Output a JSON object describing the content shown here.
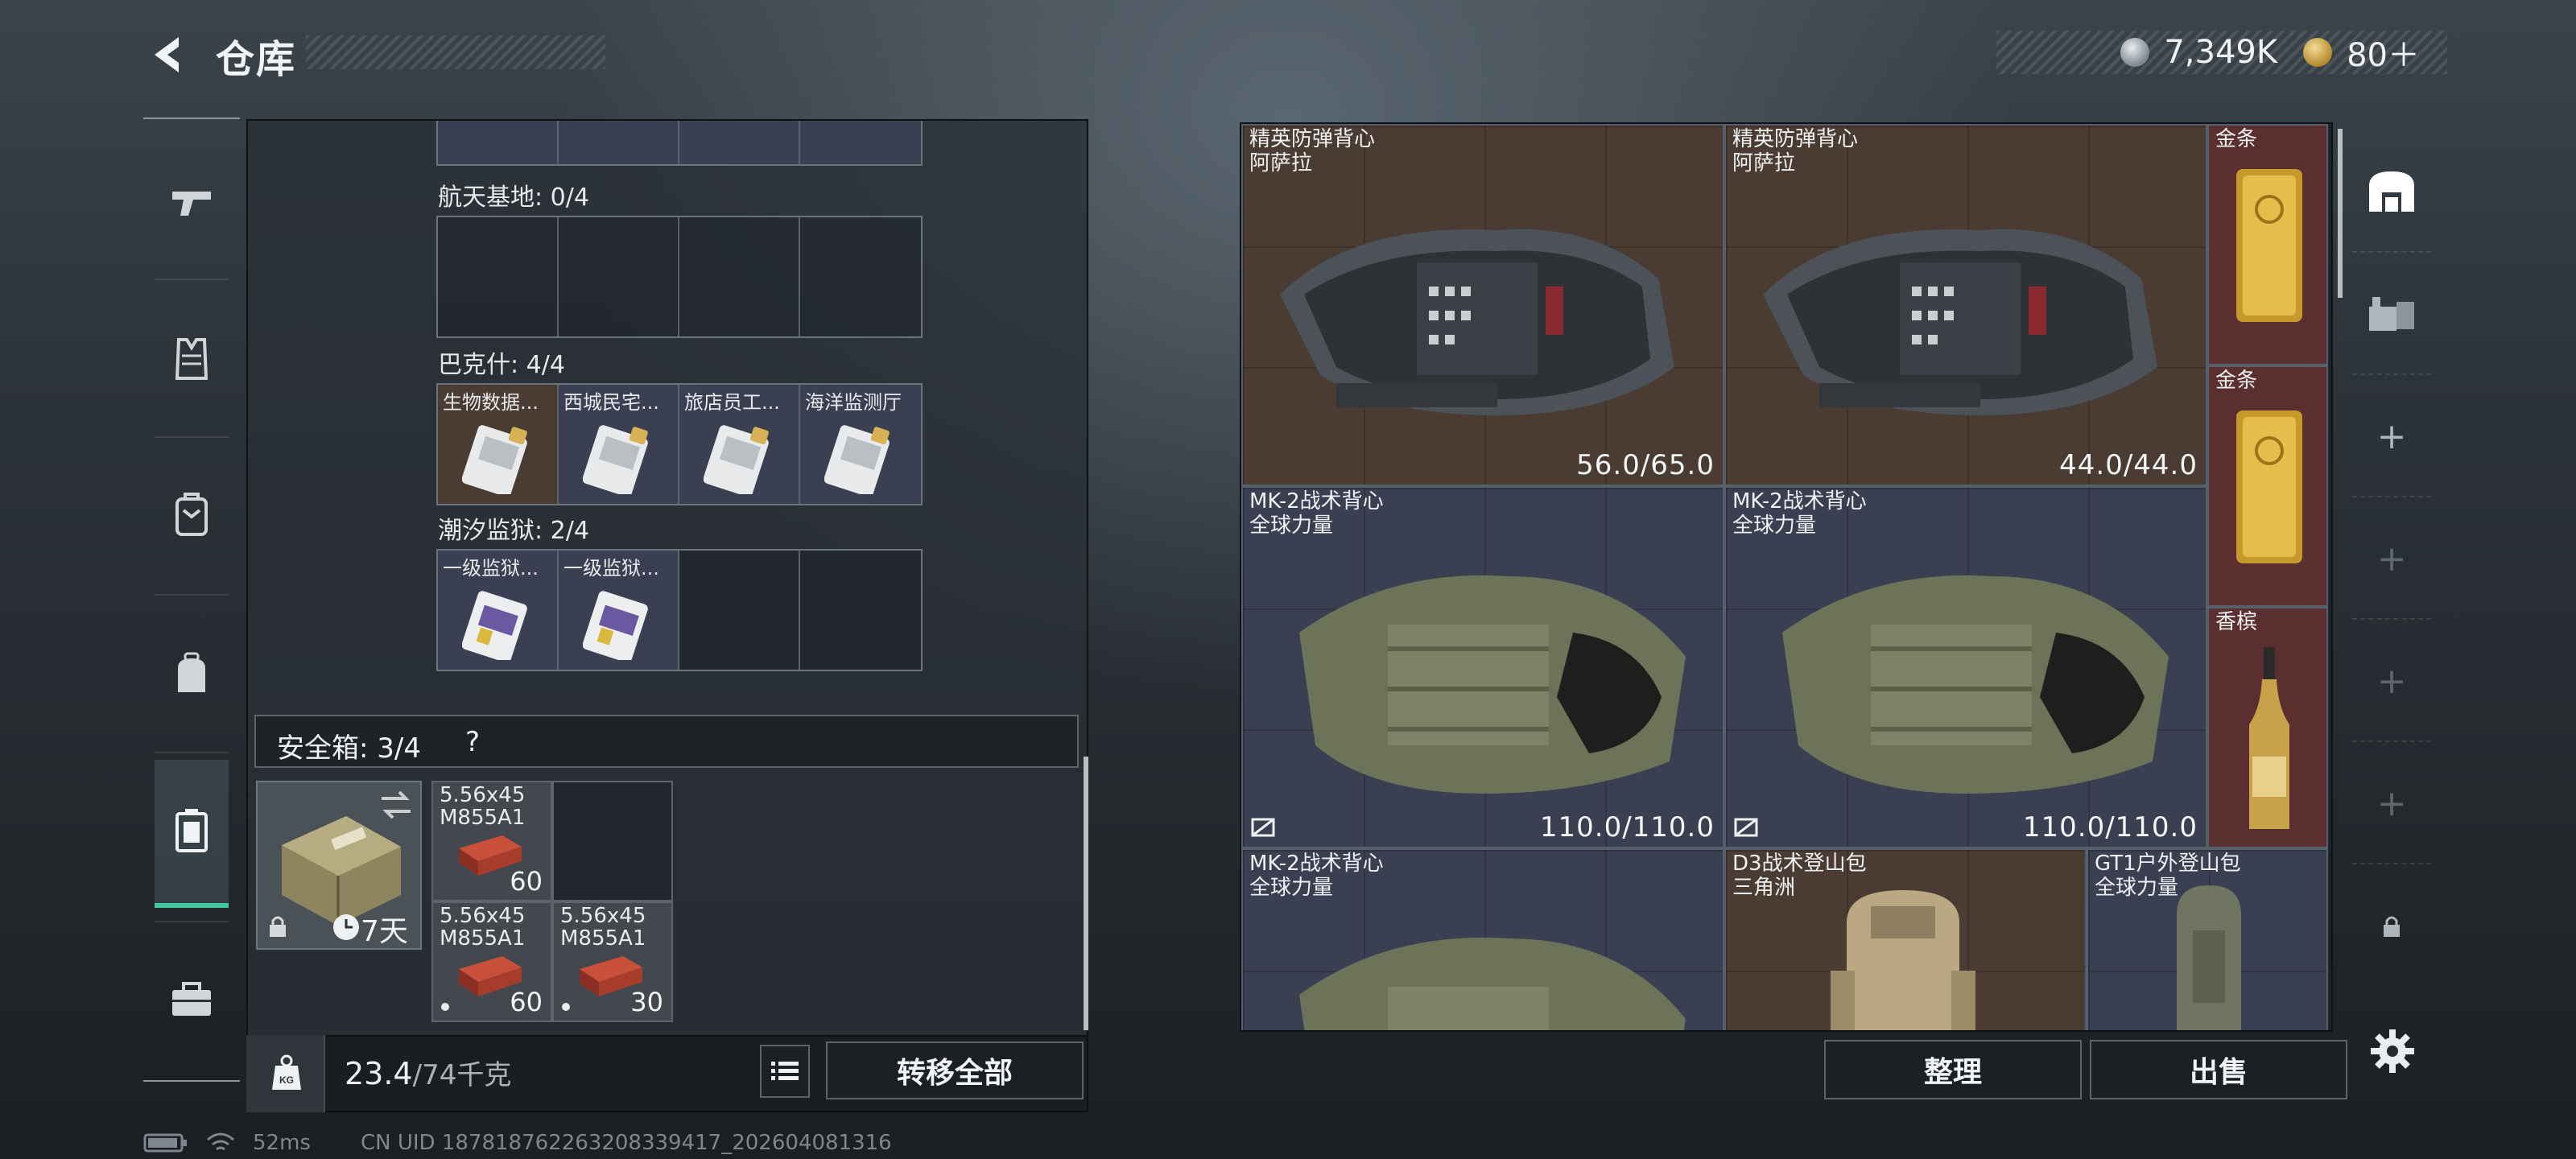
{
  "header": {
    "title": "仓库",
    "currency_a": "7,349K",
    "currency_b": "80＋"
  },
  "nav": {
    "items": [
      "weapon-icon",
      "armor-vest-icon",
      "chest-rig-icon",
      "backpack-icon",
      "safe-box-icon",
      "toolbox-icon"
    ]
  },
  "storage": {
    "sections": [
      {
        "label": "航天基地: 0/4",
        "slots": [
          "",
          "",
          "",
          ""
        ]
      },
      {
        "label": "巴克什: 4/4",
        "slots": [
          "生物数据...",
          "西城民宅...",
          "旅店员工...",
          "海洋监测厅"
        ]
      },
      {
        "label": "潮汐监狱: 2/4",
        "slots": [
          "一级监狱...",
          "一级监狱...",
          "",
          ""
        ]
      }
    ],
    "safe": {
      "label": "安全箱:  3/4",
      "help": "?",
      "days": "7天",
      "ammo": [
        {
          "name": "5.56x45 M855A1",
          "count": "60"
        },
        {
          "name": "5.56x45 M855A1",
          "count": "60"
        },
        {
          "name": "5.56x45 M855A1",
          "count": "30"
        }
      ]
    },
    "weight_value": "23.4",
    "weight_max": "/74千克",
    "transfer_all": "转移全部"
  },
  "inventory": {
    "items": [
      {
        "name": "精英防弹背心",
        "sub": "阿萨拉",
        "stat": "56.0/65.0"
      },
      {
        "name": "精英防弹背心",
        "sub": "阿萨拉",
        "stat": "44.0/44.0"
      },
      {
        "name": "金条",
        "sub": "",
        "stat": ""
      },
      {
        "name": "金条",
        "sub": "",
        "stat": ""
      },
      {
        "name": "MK-2战术背心",
        "sub": "全球力量",
        "stat": "110.0/110.0"
      },
      {
        "name": "MK-2战术背心",
        "sub": "全球力量",
        "stat": "110.0/110.0"
      },
      {
        "name": "香槟",
        "sub": "",
        "stat": ""
      },
      {
        "name": "MK-2战术背心",
        "sub": "全球力量",
        "stat": ""
      },
      {
        "name": "D3战术登山包",
        "sub": "三角洲",
        "stat": ""
      },
      {
        "name": "GT1户外登山包",
        "sub": "全球力量",
        "stat": ""
      }
    ],
    "sort": "整理",
    "sell": "出售"
  },
  "status": {
    "ping": "52ms",
    "uid": "CN UID 187818762263208339417_202604081316"
  },
  "colors": {
    "accent": "#3fc79a",
    "vest_bg": "#4b3c33",
    "rig_bg": "#3b3f52",
    "gold_bg": "#5b2f2f"
  }
}
